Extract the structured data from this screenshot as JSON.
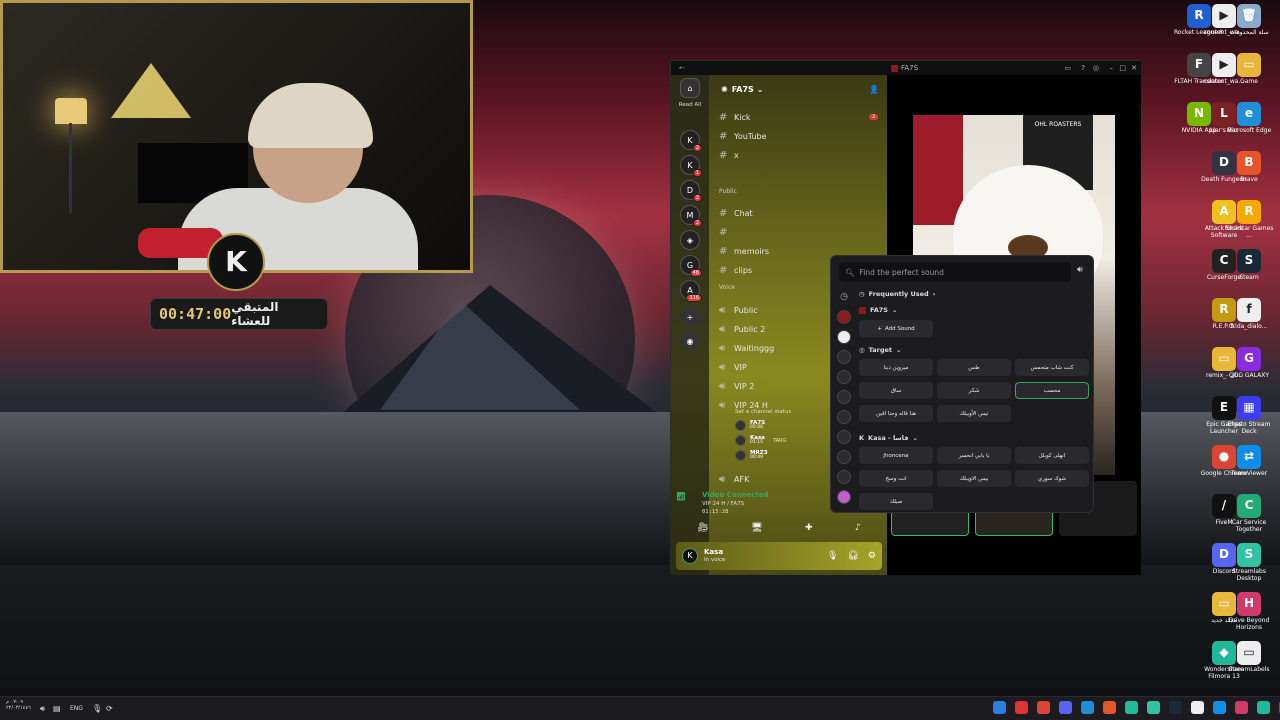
{
  "timer": {
    "time": "00:47:00",
    "label": "المتبقي للعشاء"
  },
  "webcam": {
    "logo": "K"
  },
  "desktop_icons": [
    {
      "label": "Rocket League®",
      "color": "#1f5fd0",
      "glyph": "R"
    },
    {
      "label": "content_wa...",
      "color": "#eeeeee",
      "glyph": "▶"
    },
    {
      "label": "سلة المحذوفات",
      "color": "#88aacc",
      "glyph": "🗑"
    },
    {
      "label": "FLTAH Translator",
      "color": "#444",
      "glyph": "F"
    },
    {
      "label": "content_wa...",
      "color": "#eeeeee",
      "glyph": "▶"
    },
    {
      "label": "Game",
      "color": "#e8b73a",
      "glyph": "▭"
    },
    {
      "label": "NVIDIA App",
      "color": "#76b900",
      "glyph": "N"
    },
    {
      "label": "Liar's Bar",
      "color": "#7a2222",
      "glyph": "L"
    },
    {
      "label": "Microsoft Edge",
      "color": "#1e8fd6",
      "glyph": "e"
    },
    {
      "label": "Death Fungeon",
      "color": "#334",
      "glyph": "D"
    },
    {
      "label": "Brave",
      "color": "#e5552a",
      "glyph": "B"
    },
    {
      "label": "Attack Shark Software",
      "color": "#f0c020",
      "glyph": "A"
    },
    {
      "label": "Rockstar Games ...",
      "color": "#f6a800",
      "glyph": "R"
    },
    {
      "label": "CurseForge",
      "color": "#222",
      "glyph": "C"
    },
    {
      "label": "Steam",
      "color": "#1b2838",
      "glyph": "S"
    },
    {
      "label": "R.E.P.O.",
      "color": "#c49a12",
      "glyph": "R"
    },
    {
      "label": "frida_dialo...",
      "color": "#eee",
      "glyph": "f"
    },
    {
      "label": "remix_- ال...",
      "color": "#e8b73a",
      "glyph": "▭"
    },
    {
      "label": "GOG GALAXY",
      "color": "#8a2be2",
      "glyph": "G"
    },
    {
      "label": "Epic Games Launcher",
      "color": "#111",
      "glyph": "E"
    },
    {
      "label": "Elgato Stream Deck",
      "color": "#3c3cf0",
      "glyph": "▦"
    },
    {
      "label": "Google Chrome",
      "color": "#db4437",
      "glyph": "●"
    },
    {
      "label": "TeamViewer",
      "color": "#0e8ee9",
      "glyph": "⇄"
    },
    {
      "label": "FiveM",
      "color": "#111",
      "glyph": "/"
    },
    {
      "label": "Car Service Together",
      "color": "#2a7",
      "glyph": "C"
    },
    {
      "label": "Discord",
      "color": "#5865f2",
      "glyph": "D"
    },
    {
      "label": "Streamlabs Desktop",
      "color": "#31c3a2",
      "glyph": "S"
    },
    {
      "label": "مجلد جديد",
      "color": "#e8b73a",
      "glyph": "▭"
    },
    {
      "label": "Drive Beyond Horizons",
      "color": "#d03a6a",
      "glyph": "H"
    },
    {
      "label": "Wondershare Filmora 13",
      "color": "#1fb89a",
      "glyph": "◆"
    },
    {
      "label": "StreamLabels",
      "color": "#eee",
      "glyph": "▭"
    }
  ],
  "discord": {
    "window_title": "FA7S",
    "read_all": "Read All",
    "server_name": "FA7S",
    "servers": [
      {
        "glyph": "K",
        "badge": "2"
      },
      {
        "glyph": "K",
        "badge": "1"
      },
      {
        "glyph": "D",
        "badge": "2"
      },
      {
        "glyph": "M",
        "badge": "2"
      },
      {
        "glyph": "◈",
        "badge": ""
      },
      {
        "glyph": "G",
        "badge": "48"
      },
      {
        "glyph": "A",
        "badge": "116"
      }
    ],
    "text_channels_top": [
      {
        "name": "Kick",
        "badge": "2"
      },
      {
        "name": "YouTube",
        "badge": ""
      },
      {
        "name": "x",
        "badge": ""
      }
    ],
    "category_public": "Public",
    "text_channels_public": [
      "Chat",
      "",
      "memoirs",
      "clips"
    ],
    "category_voice": "Voice",
    "voice_channels": [
      "Public",
      "Public 2",
      "Waitinggg",
      "VIP",
      "VIP 2",
      "VIP 24 H"
    ],
    "channel_status": "Set a channel status",
    "voice_members": [
      {
        "name": "FA7S",
        "time": "05:06"
      },
      {
        "name": "Kasa",
        "time": "01:15",
        "tag": "TARG"
      },
      {
        "name": "MRZ3",
        "time": "00:49"
      }
    ],
    "afk_channel": "AFK",
    "video_connected": "Video Connected",
    "connection_detail": "VIP 24 H / FA7S",
    "connection_time": "01:15:28",
    "user": {
      "name": "Kasa",
      "status": "In voice"
    }
  },
  "video": {
    "bag_text": "OHL ROASTERS"
  },
  "soundboard": {
    "search_placeholder": "Find the perfect sound",
    "frequently_used": "Frequently Used",
    "server_section": "FA7S",
    "add_sound": "Add Sound",
    "target_section": "Target",
    "target_sounds": [
      "ميروين دينا",
      "طس",
      "كنت شاب متحمس",
      "ساق",
      "شكر",
      "محسب",
      "هنا قاله وحنا اقين",
      "تيس الأوبيلك"
    ],
    "kasa_section": "Kasa - قاسا",
    "kasa_sounds": [
      "jhoncena",
      "يا بابي انحسر",
      "انهلى كوبلل",
      "انت وسخ",
      "بيس الاويبلك",
      "شوك سوري",
      "صبلك"
    ]
  },
  "taskbar": {
    "time": "٠٧:٠٩ م",
    "date": "٢٢/٠٣/١٤٤٦",
    "lang": "ENG"
  }
}
